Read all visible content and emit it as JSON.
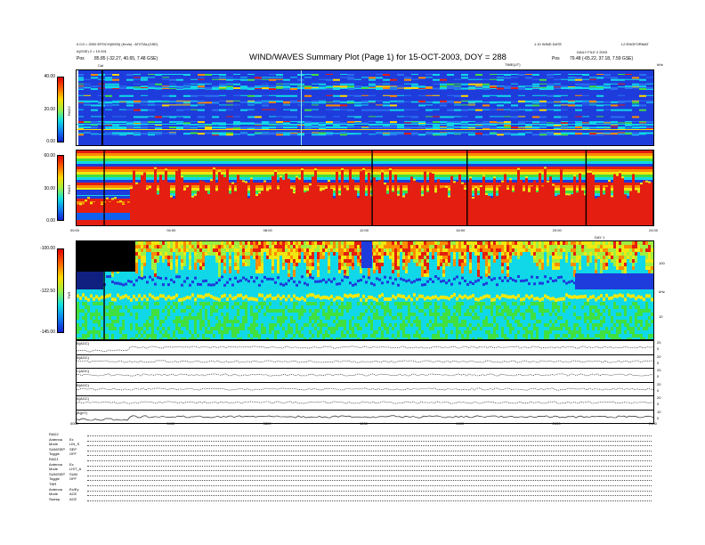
{
  "header": {
    "title": "WIND/WAVES Summary Plot (Page 1) for 15-OCT-2003, DOY = 288",
    "left_line1": "0.0.0 = 2000 EPOCH(0000) (Km/s) : ATOTAL(GSE)",
    "left_line2": "A(GSE) 2 = 10.001",
    "left_pos_label": "Pos",
    "left_pos": "85.85 (-32.27, 40.65, 7.48 GSE)",
    "right_line1": "1.10 WIND DATE",
    "right_line2": "L2 ENGFORMAT",
    "right_line3": "DAILY FILE 2 2003",
    "right_pos_label": "Pos",
    "right_pos": "79.48 (-65.22, 37.18, 7.59 GSE)",
    "time_label": "TIME(UT)",
    "freq_unit": "kHz",
    "cal_label": "Cal"
  },
  "panels": {
    "rad2": {
      "label": "RAD2",
      "ticks": [
        "40.00",
        "20.00",
        "0.00"
      ]
    },
    "rad1": {
      "label": "RAD1",
      "ticks": [
        "60.00",
        "30.00",
        "0.00"
      ]
    },
    "tnr": {
      "label": "TNR",
      "ticks": [
        "-100.00",
        "-122.50",
        "-145.00"
      ],
      "right_ticks": [
        "100",
        "10"
      ],
      "right_unit": "kHz"
    },
    "time_axis_top": [
      "00:00",
      "04:00",
      "08:00",
      "12:00",
      "16:00",
      "20:00",
      "24:00"
    ],
    "time_axis_bottom": [
      "0000",
      "0400",
      "0800",
      "1200",
      "1600",
      "2000",
      "2400"
    ],
    "date_note": "DAY 1"
  },
  "chart_data": {
    "type": "heatmap",
    "title": "WIND/WAVES Summary Plot (Page 1) for 15-OCT-2003, DOY = 288",
    "x_range_hours": [
      0,
      24
    ],
    "rows": [
      {
        "name": "RAD2",
        "ylim": [
          0,
          40
        ]
      },
      {
        "name": "RAD1",
        "ylim": [
          0,
          60
        ]
      },
      {
        "name": "TNR",
        "ylim": [
          -145,
          -100
        ]
      }
    ],
    "line_plots": [
      {
        "name": "B(AGC)",
        "right_ticks": [
          "20",
          "0"
        ]
      },
      {
        "name": "B(AGC)",
        "right_ticks": [
          "20",
          "0"
        ]
      },
      {
        "name": "C(AGC)",
        "right_ticks": [
          "20",
          "0"
        ]
      },
      {
        "name": "B(AGC)",
        "right_ticks": [
          "20",
          "0"
        ]
      },
      {
        "name": "A(AGC)",
        "right_ticks": [
          "20",
          "0"
        ]
      },
      {
        "name": "|B|(nT)",
        "right_ticks": [
          "10",
          "0"
        ]
      }
    ],
    "vertical_gaps_hours": [
      1.15,
      12.3,
      16.25,
      21.2,
      24.0
    ]
  },
  "footer": {
    "rows": [
      {
        "k": "RAD2",
        "v": ""
      },
      {
        "k": "Antenna",
        "v": "Ex"
      },
      {
        "k": "Mode",
        "v": "LIN_S"
      },
      {
        "k": "SUM/SEP",
        "v": "SEP"
      },
      {
        "k": "Toggle",
        "v": "OFF"
      },
      {
        "k": "RAD1",
        "v": ""
      },
      {
        "k": "Antenna",
        "v": "Ex"
      },
      {
        "k": "Mode",
        "v": "LIST_A"
      },
      {
        "k": "SUM/SEP",
        "v": "SUM"
      },
      {
        "k": "Toggle",
        "v": "OFF"
      },
      {
        "k": "TNR",
        "v": ""
      },
      {
        "k": "Antenna",
        "v": "Ex/Ey"
      },
      {
        "k": "Mode",
        "v": "ACE"
      },
      {
        "k": "Sweep",
        "v": "ACE"
      }
    ]
  },
  "colors": {
    "bg_blue": "#1e3cdc",
    "red": "#e41e10",
    "yellow": "#f0e810",
    "cyan": "#10d8e8",
    "green": "#40e040"
  }
}
